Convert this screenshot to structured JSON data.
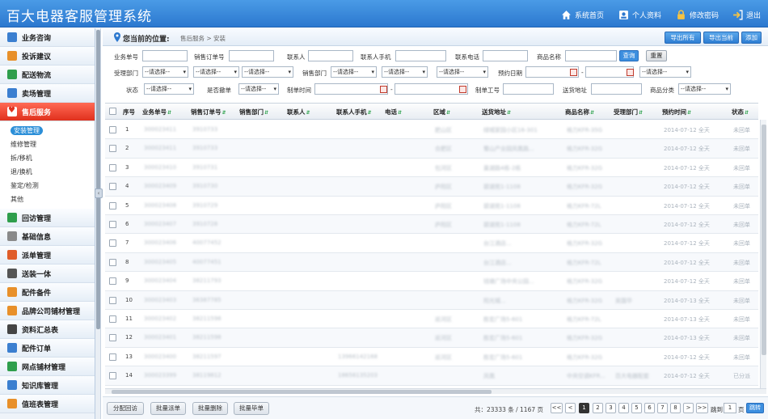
{
  "app": {
    "title": "百大电器客服管理系统",
    "nav": [
      {
        "label": "系统首页",
        "icon": "home-icon"
      },
      {
        "label": "个人资料",
        "icon": "profile-icon"
      },
      {
        "label": "修改密码",
        "icon": "lock-icon"
      },
      {
        "label": "退出",
        "icon": "logout-icon"
      }
    ]
  },
  "sidebar": {
    "items": [
      {
        "label": "业务咨询",
        "color": "#3b7fd0"
      },
      {
        "label": "投诉建议",
        "color": "#e8902a"
      },
      {
        "label": "配送物流",
        "color": "#2f9e4c"
      },
      {
        "label": "卖场管理",
        "color": "#3b7fd0"
      },
      {
        "label": "售后服务",
        "color": "#ffffff",
        "active": true
      },
      {
        "label": "回访管理",
        "color": "#2f9e4c"
      },
      {
        "label": "基础信息",
        "color": "#8a8a8a"
      },
      {
        "label": "派单管理",
        "color": "#e05d2a"
      },
      {
        "label": "送装一体",
        "color": "#555555"
      },
      {
        "label": "配件备件",
        "color": "#e8902a"
      },
      {
        "label": "品牌公司铺材管理",
        "color": "#e8902a"
      },
      {
        "label": "资料汇总表",
        "color": "#444444"
      },
      {
        "label": "配件订单",
        "color": "#3b7fd0"
      },
      {
        "label": "网点铺材管理",
        "color": "#2f9e4c"
      },
      {
        "label": "知识库管理",
        "color": "#3b7fd0"
      },
      {
        "label": "值班表管理",
        "color": "#e8902a"
      }
    ],
    "sub_items": [
      "安装管理",
      "维修管理",
      "拆/移机",
      "退/换机",
      "鉴定/检测",
      "其他"
    ],
    "collapse_glyph": "‹"
  },
  "breadcrumb": {
    "label": "您当前的位置:",
    "path": "售后服务 > 安装"
  },
  "toolbar": {
    "export_all": "导出所有",
    "export_current": "导出当前",
    "add": "添加"
  },
  "filters": {
    "row1": [
      "业务单号",
      "销售订单号",
      "联系人",
      "联系人手机",
      "联系电话",
      "商品名称"
    ],
    "row2": [
      "受理部门",
      "销售部门",
      "预约日期"
    ],
    "row3": [
      "状态",
      "是否撤单",
      "制单时间",
      "制单工号",
      "送货地址",
      "商品分类"
    ],
    "select_placeholder": "--请选择--",
    "date_sep": "-",
    "query": "查询",
    "reset": "重置"
  },
  "table": {
    "columns": [
      "序号",
      "业务单号",
      "销售订单号",
      "销售部门",
      "联系人",
      "联系人手机",
      "电话",
      "区域",
      "送货地址",
      "商品名称",
      "受理部门",
      "预约时间",
      "状态"
    ],
    "sort_glyph": "⇵",
    "rows": [
      {
        "n": "1",
        "id": "300023411",
        "order": "3910733",
        "dept": "",
        "contact": "",
        "mobile": "",
        "phone": "",
        "area": "肥山区",
        "addr": "绿城家园小区16-301",
        "product": "格力KFR-35G",
        "acc": "",
        "date": "2014-07-12 全天",
        "status": "未回单"
      },
      {
        "n": "2",
        "id": "300023411",
        "order": "3910733",
        "dept": "",
        "contact": "",
        "mobile": "",
        "phone": "",
        "area": "合肥区",
        "addr": "蜀山产业园凤凰路...",
        "product": "格力KFR-32G",
        "acc": "",
        "date": "2014-07-12 全天",
        "status": "未回单"
      },
      {
        "n": "3",
        "id": "300023410",
        "order": "3910731",
        "dept": "",
        "contact": "",
        "mobile": "",
        "phone": "",
        "area": "包河区",
        "addr": "巢湖路4栋-2栋",
        "product": "格力KFR-32G",
        "acc": "",
        "date": "2014-07-12 全天",
        "status": "未回单"
      },
      {
        "n": "4",
        "id": "300023409",
        "order": "3910730",
        "dept": "",
        "contact": "",
        "mobile": "",
        "phone": "",
        "area": "庐阳区",
        "addr": "碧湖苑1-1108",
        "product": "格力KFR-32G",
        "acc": "",
        "date": "2014-07-12 全天",
        "status": "未回单"
      },
      {
        "n": "5",
        "id": "300023408",
        "order": "3910729",
        "dept": "",
        "contact": "",
        "mobile": "",
        "phone": "",
        "area": "庐阳区",
        "addr": "碧湖苑1-1108",
        "product": "格力KFR-72L",
        "acc": "",
        "date": "2014-07-12 全天",
        "status": "未回单"
      },
      {
        "n": "6",
        "id": "300023407",
        "order": "3910728",
        "dept": "",
        "contact": "",
        "mobile": "",
        "phone": "",
        "area": "庐阳区",
        "addr": "碧湖苑1-1108",
        "product": "格力KFR-72L",
        "acc": "",
        "date": "2014-07-12 全天",
        "status": "未回单"
      },
      {
        "n": "7",
        "id": "300023406",
        "order": "40077452",
        "dept": "",
        "contact": "",
        "mobile": "",
        "phone": "",
        "area": "",
        "addr": "台江酒店...",
        "product": "格力KFR-32G",
        "acc": "",
        "date": "2014-07-12 全天",
        "status": "未回单"
      },
      {
        "n": "8",
        "id": "300023405",
        "order": "40077451",
        "dept": "",
        "contact": "",
        "mobile": "",
        "phone": "",
        "area": "",
        "addr": "台江酒店...",
        "product": "格力KFR-72L",
        "acc": "",
        "date": "2014-07-12 全天",
        "status": "未回单"
      },
      {
        "n": "9",
        "id": "300023404",
        "order": "38211793",
        "dept": "",
        "contact": "",
        "mobile": "",
        "phone": "",
        "area": "",
        "addr": "钱塘广场中央公园...",
        "product": "格力KFR-32G",
        "acc": "",
        "date": "2014-07-12 全天",
        "status": "未回单"
      },
      {
        "n": "10",
        "id": "300023403",
        "order": "36387785",
        "dept": "",
        "contact": "",
        "mobile": "",
        "phone": "",
        "area": "",
        "addr": "阳光城...",
        "product": "格力KFR-32G",
        "acc": "吴国华",
        "date": "2014-07-13 全天",
        "status": "未回单"
      },
      {
        "n": "11",
        "id": "300023402",
        "order": "38211598",
        "dept": "",
        "contact": "",
        "mobile": "",
        "phone": "",
        "area": "巡河区",
        "addr": "胜宏广场5-601",
        "product": "格力KFR-72L",
        "acc": "",
        "date": "2014-07-13 全天",
        "status": "未回单"
      },
      {
        "n": "12",
        "id": "300023401",
        "order": "38211598",
        "dept": "",
        "contact": "",
        "mobile": "",
        "phone": "",
        "area": "巡河区",
        "addr": "胜宏广场5-601",
        "product": "格力KFR-32G",
        "acc": "",
        "date": "2014-07-13 全天",
        "status": "未回单"
      },
      {
        "n": "13",
        "id": "300023400",
        "order": "38211597",
        "dept": "",
        "contact": "",
        "mobile": "13966142168",
        "phone": "",
        "area": "巡河区",
        "addr": "胜宏广场5-601",
        "product": "格力KFR-32G",
        "acc": "",
        "date": "2014-07-12 全天",
        "status": "未回单"
      },
      {
        "n": "14",
        "id": "300023399",
        "order": "38119812",
        "dept": "",
        "contact": "",
        "mobile": "18656135203",
        "phone": "",
        "area": "",
        "addr": "凤凰",
        "product": "中央空调KFR...",
        "acc": "百大电器配套",
        "date": "2014-07-12 全天",
        "status": "已分派"
      }
    ]
  },
  "footer": {
    "buttons": [
      "分配回访",
      "批量派单",
      "批量删除",
      "批量毕单"
    ],
    "summary": "共：23333 条 / 1167 页",
    "first": "<<",
    "prev": "<",
    "pages": [
      "1",
      "2",
      "3",
      "4",
      "5",
      "6",
      "7",
      "8"
    ],
    "next": ">",
    "last": ">>",
    "goto_label": "跳到",
    "goto_value": "1",
    "page_unit": "页",
    "go": "跳转"
  }
}
